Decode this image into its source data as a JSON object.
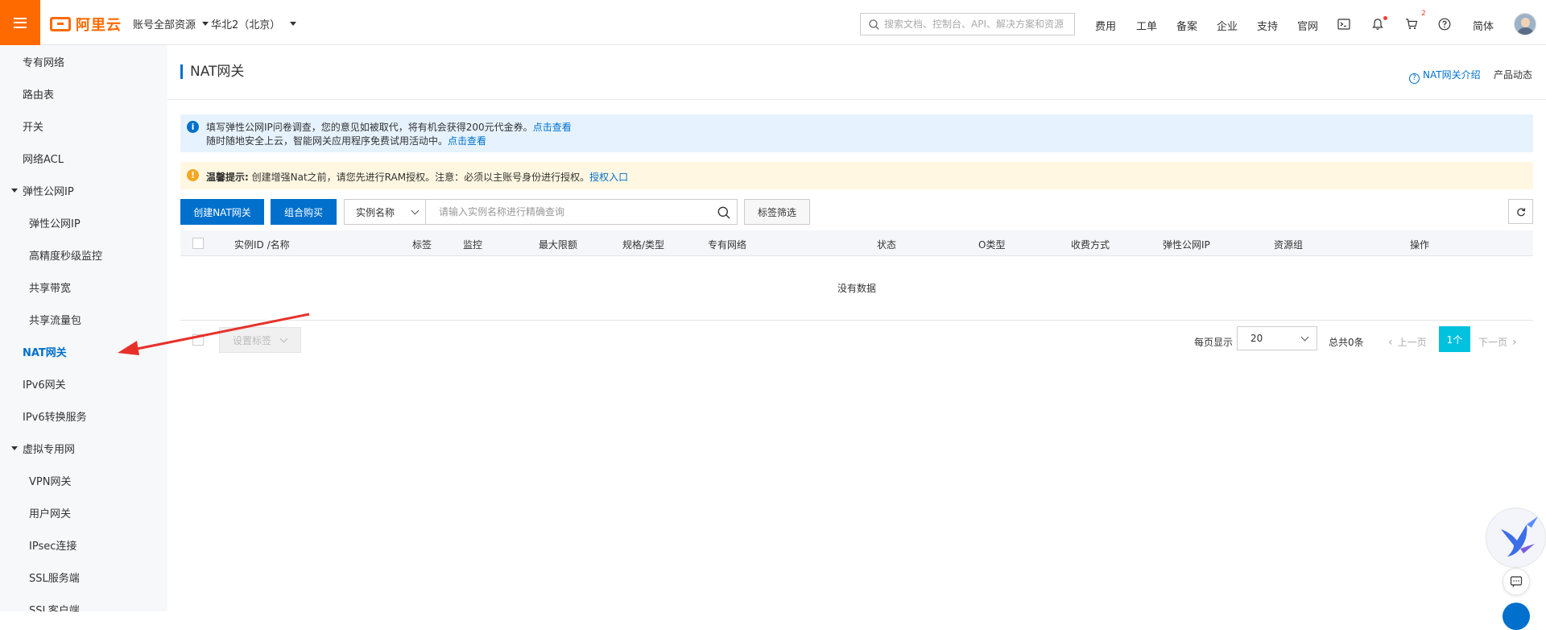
{
  "colors": {
    "brand": "#ff6a00",
    "primary": "#0070cc",
    "pager_active": "#00c1de",
    "info_bg": "#e6f3ff",
    "warn_bg": "#fff7e1"
  },
  "topbar": {
    "logo_text": "阿里云",
    "account_scope": "账号全部资源",
    "region": "华北2（北京）",
    "search_placeholder": "搜索文档、控制台、API、解决方案和资源",
    "nav": [
      "费用",
      "工单",
      "备案",
      "企业",
      "支持",
      "官网"
    ],
    "cart_count": "2",
    "language": "简体",
    "icons": [
      "terminal-icon",
      "bell-icon",
      "cart-icon",
      "help-icon"
    ]
  },
  "sidebar": {
    "items": [
      {
        "label": "专有网络",
        "level": 1
      },
      {
        "label": "路由表",
        "level": 1
      },
      {
        "label": "开关",
        "level": 1
      },
      {
        "label": "网络ACL",
        "level": 1
      },
      {
        "label": "弹性公网IP",
        "level": 0
      },
      {
        "label": "弹性公网IP",
        "level": 2
      },
      {
        "label": "高精度秒级监控",
        "level": 2
      },
      {
        "label": "共享带宽",
        "level": 2
      },
      {
        "label": "共享流量包",
        "level": 2
      },
      {
        "label": "NAT网关",
        "level": 1,
        "active": true
      },
      {
        "label": "IPv6网关",
        "level": 1
      },
      {
        "label": "IPv6转换服务",
        "level": 1
      },
      {
        "label": "虚拟专用网",
        "level": 0
      },
      {
        "label": "VPN网关",
        "level": 2
      },
      {
        "label": "用户网关",
        "level": 2
      },
      {
        "label": "IPsec连接",
        "level": 2
      },
      {
        "label": "SSL服务端",
        "level": 2
      },
      {
        "label": "SSL客户端",
        "level": 2
      }
    ]
  },
  "page": {
    "title": "NAT网关",
    "intro_link": "NAT网关介绍",
    "product_news": "产品动态"
  },
  "notice_info": {
    "line1": "填写弹性公网IP问卷调查，您的意见如被取代，将有机会获得200元代金券。",
    "line1_link": "点击查看",
    "line2": "随时随地安全上云，智能网关应用程序免费试用活动中。",
    "line2_link": "点击查看"
  },
  "notice_warn": {
    "label": "温馨提示:",
    "text": "创建增强Nat之前，请您先进行RAM授权。注意：必须以主账号身份进行授权。",
    "link": "授权入口"
  },
  "toolbar": {
    "create_button": "创建NAT网关",
    "combo_button": "组合购买",
    "filter_select": "实例名称",
    "search_placeholder": "请输入实例名称进行精确查询",
    "tag_filter": "标签筛选"
  },
  "table": {
    "columns": [
      "实例ID /名称",
      "标签",
      "监控",
      "最大限额",
      "规格/类型",
      "专有网络",
      "状态",
      "O类型",
      "收费方式",
      "弹性公网IP",
      "资源组",
      "操作"
    ],
    "empty_text": "没有数据"
  },
  "footer": {
    "set_tag_button": "设置标签",
    "per_page_label": "每页显示",
    "per_page_value": "20",
    "total": "总共0条",
    "prev": "上一页",
    "current_page": "1个",
    "next": "下一页"
  }
}
